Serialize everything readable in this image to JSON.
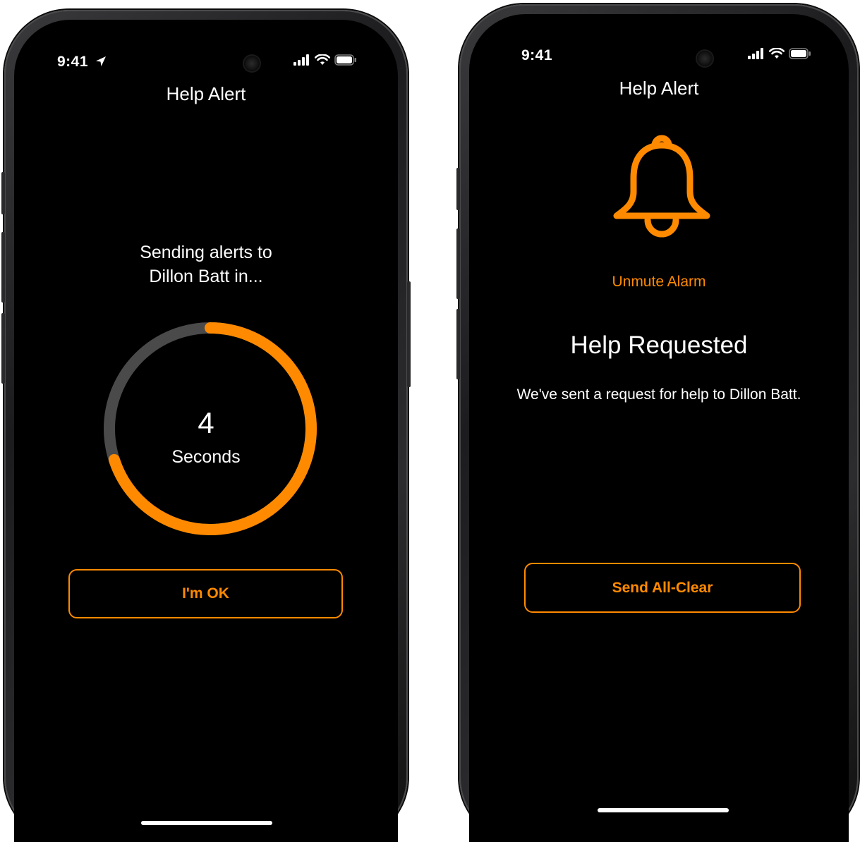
{
  "colors": {
    "accent": "#ff8a00",
    "background": "#000000",
    "track": "#4a4a4a",
    "text": "#ffffff"
  },
  "left_screen": {
    "status": {
      "time": "9:41",
      "location_icon": "location-arrow-icon",
      "icons": [
        "signal-icon",
        "wifi-icon",
        "battery-icon"
      ]
    },
    "nav_title": "Help Alert",
    "message_line1": "Sending alerts to",
    "message_line2": "Dillon Batt in...",
    "countdown": {
      "value": "4",
      "unit": "Seconds",
      "progress_fraction": 0.7
    },
    "ok_button_label": "I'm OK"
  },
  "right_screen": {
    "status": {
      "time": "9:41",
      "icons": [
        "signal-icon",
        "wifi-icon",
        "battery-icon"
      ]
    },
    "nav_title": "Help Alert",
    "bell_icon": "bell-icon",
    "unmute_label": "Unmute Alarm",
    "heading": "Help Requested",
    "description": "We've sent a request for help to Dillon Batt.",
    "all_clear_button_label": "Send All-Clear"
  }
}
